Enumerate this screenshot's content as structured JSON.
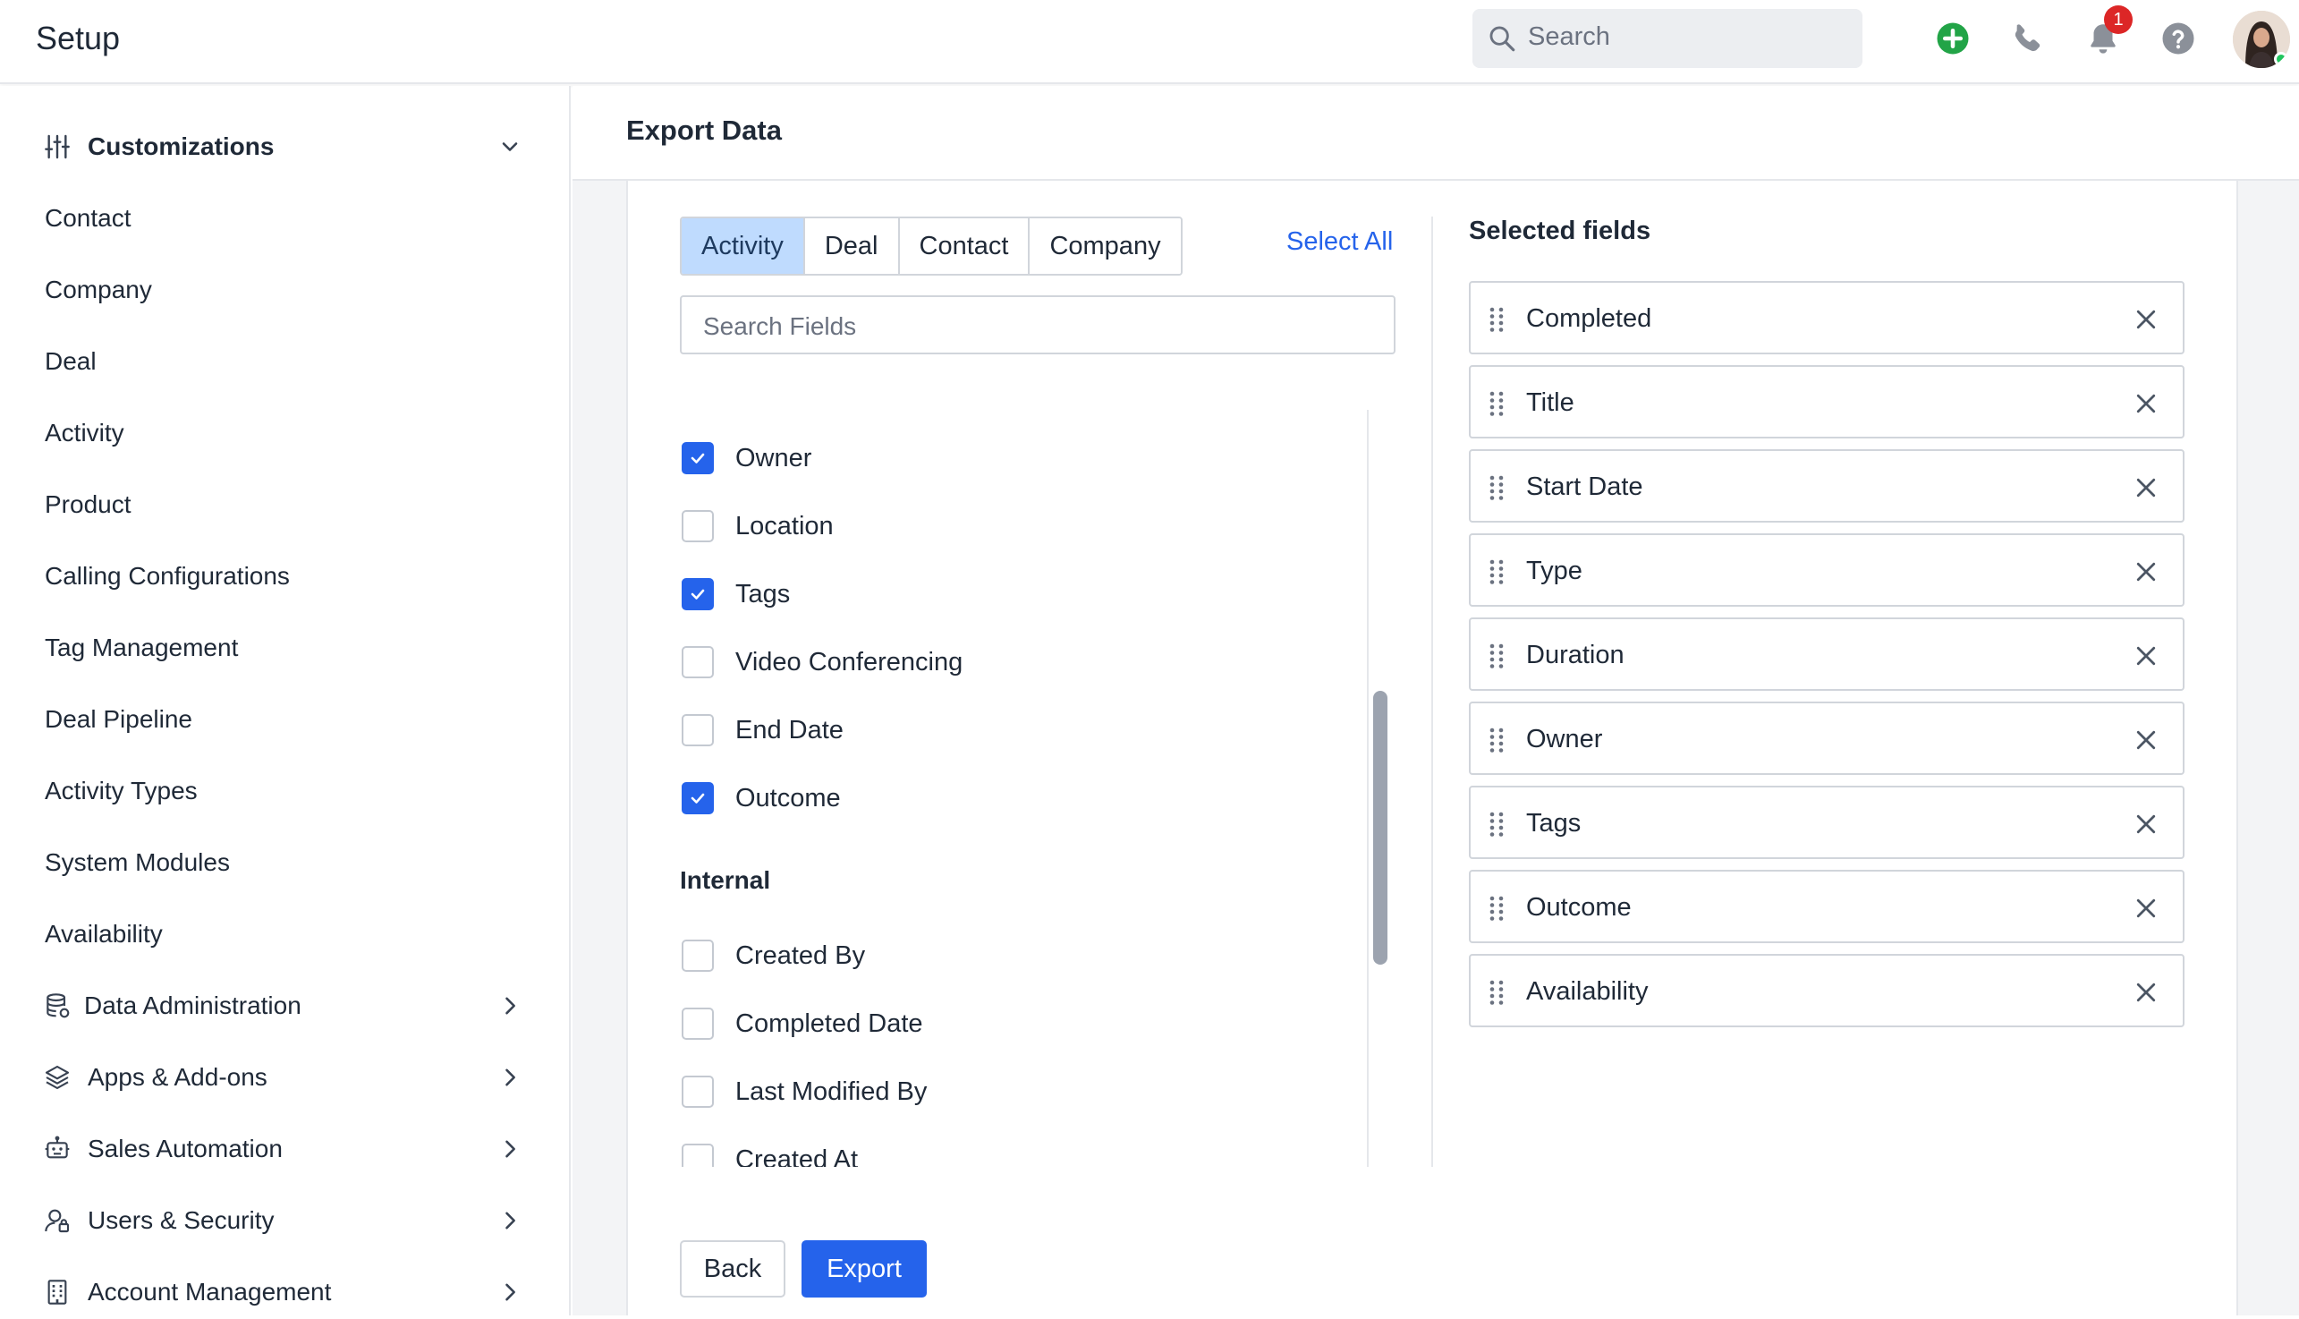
{
  "app": {
    "title": "Setup"
  },
  "topbar": {
    "search_placeholder": "Search",
    "notification_count": "1",
    "icons": [
      "add-circle-icon",
      "phone-icon",
      "bell-icon",
      "help-icon"
    ]
  },
  "sidebar": {
    "top_group": {
      "label": "Customizations",
      "icon": "sliders-icon"
    },
    "items": [
      {
        "label": "Contact"
      },
      {
        "label": "Company"
      },
      {
        "label": "Deal"
      },
      {
        "label": "Activity"
      },
      {
        "label": "Product"
      },
      {
        "label": "Calling Configurations"
      },
      {
        "label": "Tag Management"
      },
      {
        "label": "Deal Pipeline"
      },
      {
        "label": "Activity Types"
      },
      {
        "label": "System Modules"
      },
      {
        "label": "Availability"
      }
    ],
    "groups": [
      {
        "label": "Data Administration",
        "icon": "database-icon"
      },
      {
        "label": "Apps & Add-ons",
        "icon": "layers-icon"
      },
      {
        "label": "Sales Automation",
        "icon": "robot-icon"
      },
      {
        "label": "Users & Security",
        "icon": "user-lock-icon"
      },
      {
        "label": "Account Management",
        "icon": "building-icon"
      }
    ]
  },
  "main": {
    "title": "Export Data",
    "tabs": [
      {
        "label": "Activity",
        "active": true
      },
      {
        "label": "Deal",
        "active": false
      },
      {
        "label": "Contact",
        "active": false
      },
      {
        "label": "Company",
        "active": false
      }
    ],
    "select_all_label": "Select All",
    "search_fields_placeholder": "Search Fields",
    "fields": [
      {
        "label": "Owner",
        "checked": true
      },
      {
        "label": "Location",
        "checked": false
      },
      {
        "label": "Tags",
        "checked": true
      },
      {
        "label": "Video Conferencing",
        "checked": false
      },
      {
        "label": "End Date",
        "checked": false
      },
      {
        "label": "Outcome",
        "checked": true
      }
    ],
    "internal_section_title": "Internal",
    "internal_fields": [
      {
        "label": "Created By",
        "checked": false
      },
      {
        "label": "Completed Date",
        "checked": false
      },
      {
        "label": "Last Modified By",
        "checked": false
      },
      {
        "label": "Created At",
        "checked": false
      }
    ],
    "selected_title": "Selected fields",
    "selected_fields": [
      "Completed",
      "Title",
      "Start Date",
      "Type",
      "Duration",
      "Owner",
      "Tags",
      "Outcome",
      "Availability"
    ],
    "back_label": "Back",
    "export_label": "Export"
  },
  "colors": {
    "accent": "#2563eb",
    "tab_active_bg": "#bfdbfe",
    "badge": "#dc2626",
    "add_icon": "#22a447"
  }
}
